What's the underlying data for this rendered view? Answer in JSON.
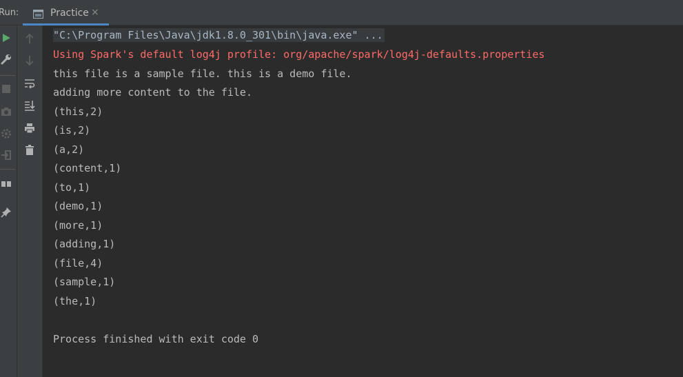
{
  "run_panel": {
    "label": "Run:",
    "tab_label": "Practice",
    "tab_close": "×"
  },
  "console": {
    "command_line": "\"C:\\Program Files\\Java\\jdk1.8.0_301\\bin\\java.exe\" ...",
    "lines": [
      {
        "text": "Using Spark's default log4j profile: org/apache/spark/log4j-defaults.properties",
        "kind": "stderr"
      },
      {
        "text": "this file is a sample file. this is a demo file.",
        "kind": "stdout"
      },
      {
        "text": "adding more content to the file.",
        "kind": "stdout"
      },
      {
        "text": "(this,2)",
        "kind": "stdout"
      },
      {
        "text": "(is,2)",
        "kind": "stdout"
      },
      {
        "text": "(a,2)",
        "kind": "stdout"
      },
      {
        "text": "(content,1)",
        "kind": "stdout"
      },
      {
        "text": "(to,1)",
        "kind": "stdout"
      },
      {
        "text": "(demo,1)",
        "kind": "stdout"
      },
      {
        "text": "(more,1)",
        "kind": "stdout"
      },
      {
        "text": "(adding,1)",
        "kind": "stdout"
      },
      {
        "text": "(file,4)",
        "kind": "stdout"
      },
      {
        "text": "(sample,1)",
        "kind": "stdout"
      },
      {
        "text": "(the,1)",
        "kind": "stdout"
      },
      {
        "text": "",
        "kind": "stdout"
      },
      {
        "text": "Process finished with exit code 0",
        "kind": "stdout"
      }
    ]
  },
  "left_toolbar": {
    "buttons": [
      "rerun-icon",
      "wrench-icon",
      "stop-icon",
      "camera-icon",
      "settings-icon",
      "login-icon",
      "layout-icon",
      "pin-icon"
    ]
  },
  "console_toolbar": {
    "buttons": [
      "up-arrow-icon",
      "down-arrow-icon",
      "soft-wrap-icon",
      "scroll-to-end-icon",
      "print-icon",
      "trash-icon"
    ]
  },
  "colors": {
    "background": "#2b2b2b",
    "panel": "#3c3f41",
    "stdout": "#bbbbbb",
    "stderr": "#ff6b68",
    "run_green": "#59a869",
    "tab_underline": "#4a88c7"
  }
}
